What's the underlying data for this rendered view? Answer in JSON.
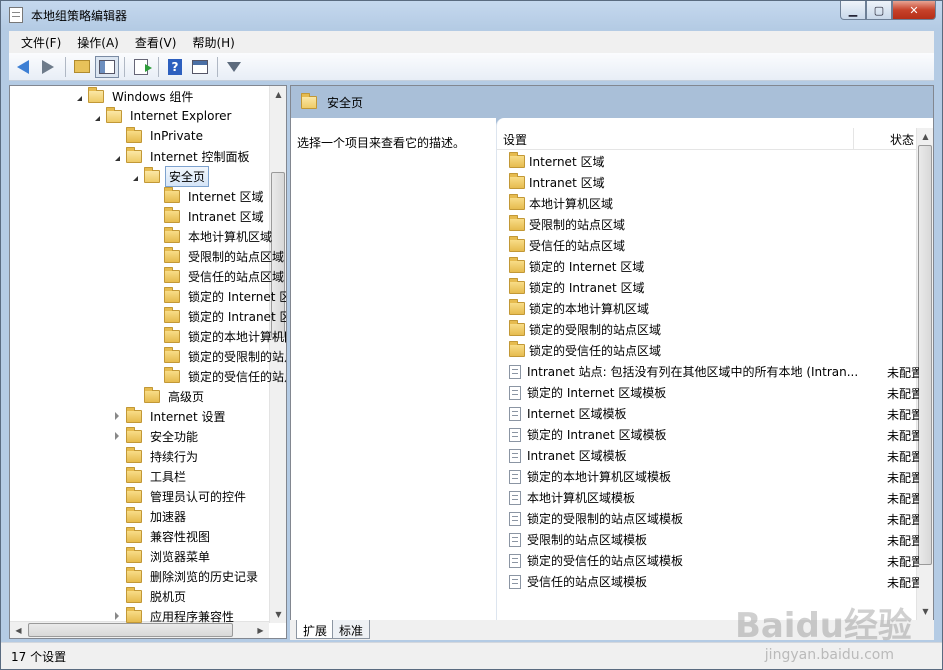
{
  "window": {
    "title": "本地组策略编辑器"
  },
  "menubar": {
    "items": [
      "文件(F)",
      "操作(A)",
      "查看(V)",
      "帮助(H)"
    ]
  },
  "toolbar": {
    "icons": [
      "back-icon",
      "forward-icon",
      "up-folder-icon",
      "show-hide-tree-icon",
      "export-list-icon",
      "help-icon",
      "properties-icon",
      "filter-icon"
    ]
  },
  "tree": {
    "items": [
      {
        "label": "Windows 组件",
        "level": 0,
        "expander": "open"
      },
      {
        "label": "Internet Explorer",
        "level": 1,
        "expander": "open"
      },
      {
        "label": "InPrivate",
        "level": 2,
        "expander": "none"
      },
      {
        "label": "Internet 控制面板",
        "level": 2,
        "expander": "open"
      },
      {
        "label": "安全页",
        "level": 3,
        "expander": "open",
        "selected": true
      },
      {
        "label": "Internet 区域",
        "level": 4,
        "expander": "none"
      },
      {
        "label": "Intranet 区域",
        "level": 4,
        "expander": "none"
      },
      {
        "label": "本地计算机区域",
        "level": 4,
        "expander": "none"
      },
      {
        "label": "受限制的站点区域",
        "level": 4,
        "expander": "none"
      },
      {
        "label": "受信任的站点区域",
        "level": 4,
        "expander": "none"
      },
      {
        "label": "锁定的 Internet 区",
        "level": 4,
        "expander": "none"
      },
      {
        "label": "锁定的 Intranet 区",
        "level": 4,
        "expander": "none"
      },
      {
        "label": "锁定的本地计算机[",
        "level": 4,
        "expander": "none"
      },
      {
        "label": "锁定的受限制的站点",
        "level": 4,
        "expander": "none"
      },
      {
        "label": "锁定的受信任的站点",
        "level": 4,
        "expander": "none"
      },
      {
        "label": "高级页",
        "level": 3,
        "expander": "none"
      },
      {
        "label": "Internet 设置",
        "level": 2,
        "expander": "closed"
      },
      {
        "label": "安全功能",
        "level": 2,
        "expander": "closed"
      },
      {
        "label": "持续行为",
        "level": 2,
        "expander": "none"
      },
      {
        "label": "工具栏",
        "level": 2,
        "expander": "none"
      },
      {
        "label": "管理员认可的控件",
        "level": 2,
        "expander": "none"
      },
      {
        "label": "加速器",
        "level": 2,
        "expander": "none"
      },
      {
        "label": "兼容性视图",
        "level": 2,
        "expander": "none"
      },
      {
        "label": "浏览器菜单",
        "level": 2,
        "expander": "none"
      },
      {
        "label": "删除浏览的历史记录",
        "level": 2,
        "expander": "none"
      },
      {
        "label": "脱机页",
        "level": 2,
        "expander": "none"
      },
      {
        "label": "应用程序兼容性",
        "level": 2,
        "expander": "closed"
      }
    ]
  },
  "right": {
    "header_title": "安全页",
    "description": "选择一个项目来查看它的描述。",
    "columns": {
      "setting": "设置",
      "state": "状态"
    },
    "rows": [
      {
        "name": "Internet 区域",
        "type": "folder",
        "state": ""
      },
      {
        "name": "Intranet 区域",
        "type": "folder",
        "state": ""
      },
      {
        "name": "本地计算机区域",
        "type": "folder",
        "state": ""
      },
      {
        "name": "受限制的站点区域",
        "type": "folder",
        "state": ""
      },
      {
        "name": "受信任的站点区域",
        "type": "folder",
        "state": ""
      },
      {
        "name": "锁定的 Internet 区域",
        "type": "folder",
        "state": ""
      },
      {
        "name": "锁定的 Intranet 区域",
        "type": "folder",
        "state": ""
      },
      {
        "name": "锁定的本地计算机区域",
        "type": "folder",
        "state": ""
      },
      {
        "name": "锁定的受限制的站点区域",
        "type": "folder",
        "state": ""
      },
      {
        "name": "锁定的受信任的站点区域",
        "type": "folder",
        "state": ""
      },
      {
        "name": "Intranet 站点: 包括没有列在其他区域中的所有本地 (Intran...",
        "type": "setting",
        "state": "未配置"
      },
      {
        "name": "锁定的 Internet 区域模板",
        "type": "setting",
        "state": "未配置"
      },
      {
        "name": "Internet 区域模板",
        "type": "setting",
        "state": "未配置"
      },
      {
        "name": "锁定的 Intranet 区域模板",
        "type": "setting",
        "state": "未配置"
      },
      {
        "name": "Intranet 区域模板",
        "type": "setting",
        "state": "未配置"
      },
      {
        "name": "锁定的本地计算机区域模板",
        "type": "setting",
        "state": "未配置"
      },
      {
        "name": "本地计算机区域模板",
        "type": "setting",
        "state": "未配置"
      },
      {
        "name": "锁定的受限制的站点区域模板",
        "type": "setting",
        "state": "未配置"
      },
      {
        "name": "受限制的站点区域模板",
        "type": "setting",
        "state": "未配置"
      },
      {
        "name": "锁定的受信任的站点区域模板",
        "type": "setting",
        "state": "未配置"
      },
      {
        "name": "受信任的站点区域模板",
        "type": "setting",
        "state": "未配置"
      }
    ],
    "tabs": [
      "扩展",
      "标准"
    ]
  },
  "statusbar": {
    "text": "17 个设置"
  },
  "watermark": {
    "brand": "Baidu经验",
    "url": "jingyan.baidu.com"
  }
}
